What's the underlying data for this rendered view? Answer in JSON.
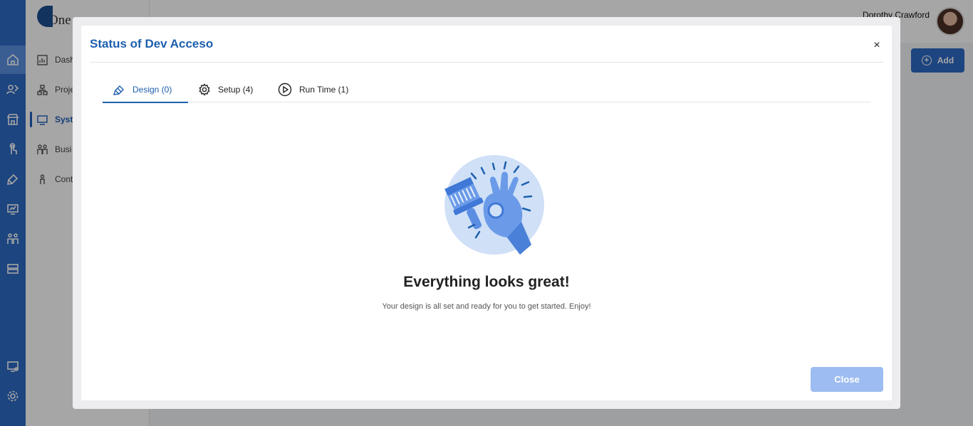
{
  "app": {
    "logo_text": "One",
    "user_name": "Dorothy Crawford",
    "add_label": "Add",
    "nav": [
      {
        "label": "Dash"
      },
      {
        "label": "Proje"
      },
      {
        "label": "Syste"
      },
      {
        "label": "Busi"
      },
      {
        "label": "Cont"
      }
    ]
  },
  "modal": {
    "title": "Status of Dev Acceso",
    "close_icon": "×",
    "tabs": [
      {
        "label": "Design (0)",
        "icon": "brush-icon",
        "active": true
      },
      {
        "label": "Setup (4)",
        "icon": "gear-icon",
        "active": false
      },
      {
        "label": "Run Time (1)",
        "icon": "play-circle-icon",
        "active": false
      }
    ],
    "empty_state": {
      "title": "Everything looks great!",
      "subtitle": "Your design is all set and ready for you to get started. Enjoy!"
    },
    "close_button": "Close"
  },
  "colors": {
    "accent": "#1d5fae",
    "rail": "#2d6bc4",
    "close_button": "#9dbcf1",
    "illustration_circle": "#cfe0f7"
  }
}
